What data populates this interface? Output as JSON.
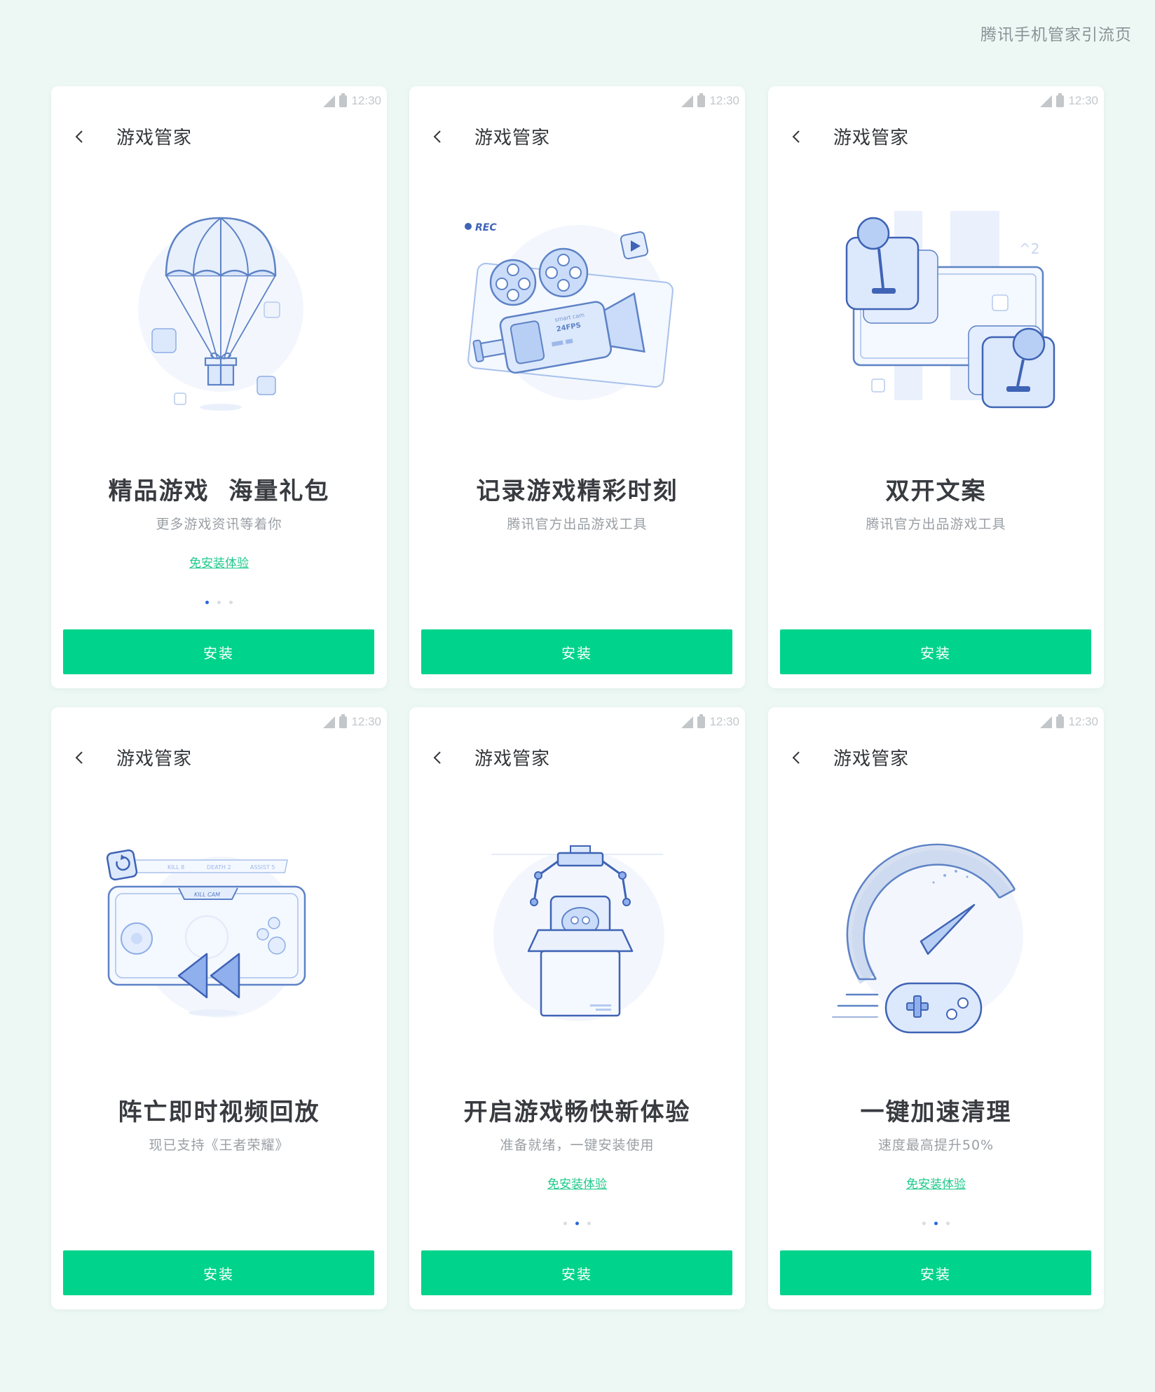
{
  "page": {
    "caption": "腾讯手机管家引流页"
  },
  "colors": {
    "background": "#edf8f4",
    "accent_green": "#00d38b",
    "link_green": "#1fc98c",
    "active_dot": "#2a66e0",
    "illustration_blue": "#5d82c6"
  },
  "screens": [
    {
      "status_time": "12:30",
      "nav_title": "游戏管家",
      "illustration_icon": "parachute-gift-icon",
      "headline": "精品游戏  海量礼包",
      "subline": "更多游戏资讯等着你",
      "trial_link": "免安装体验",
      "pager": {
        "count": 3,
        "active": 1
      },
      "install_label": "安装"
    },
    {
      "status_time": "12:30",
      "nav_title": "游戏管家",
      "illustration_icon": "video-camera-icon",
      "illustration_texts": {
        "rec": "REC",
        "brand": "smart cam",
        "fps": "24FPS"
      },
      "headline": "记录游戏精彩时刻",
      "subline": "腾讯官方出品游戏工具",
      "install_label": "安装"
    },
    {
      "status_time": "12:30",
      "nav_title": "游戏管家",
      "illustration_icon": "dual-joystick-icon",
      "illustration_texts": {
        "power": "^2"
      },
      "headline": "双开文案",
      "subline": "腾讯官方出品游戏工具",
      "install_label": "安装"
    },
    {
      "status_time": "12:30",
      "nav_title": "游戏管家",
      "illustration_icon": "rewind-replay-icon",
      "illustration_texts": {
        "kill": "KILL 8",
        "death": "DEATH 2",
        "assist": "ASSIST 5",
        "killcam": "KILL CAM"
      },
      "headline": "阵亡即时视频回放",
      "subline": "现已支持《王者荣耀》",
      "install_label": "安装"
    },
    {
      "status_time": "12:30",
      "nav_title": "游戏管家",
      "illustration_icon": "claw-box-icon",
      "headline": "开启游戏畅快新体验",
      "subline": "准备就绪，一键安装使用",
      "trial_link": "免安装体验",
      "pager": {
        "count": 3,
        "active": 2
      },
      "install_label": "安装"
    },
    {
      "status_time": "12:30",
      "nav_title": "游戏管家",
      "illustration_icon": "speedometer-gamepad-icon",
      "headline": "一键加速清理",
      "subline": "速度最高提升50%",
      "trial_link": "免安装体验",
      "pager": {
        "count": 3,
        "active": 2
      },
      "install_label": "安装"
    }
  ]
}
